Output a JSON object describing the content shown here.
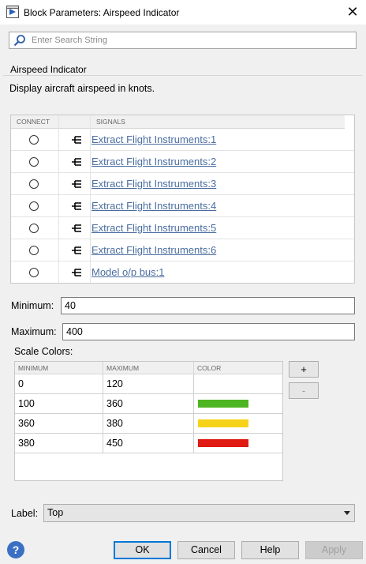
{
  "window": {
    "title": "Block Parameters: Airspeed Indicator",
    "close_glyph": "✕"
  },
  "search": {
    "placeholder": "Enter Search String",
    "value": ""
  },
  "group": {
    "title": "Airspeed Indicator",
    "description": "Display aircraft airspeed in knots."
  },
  "signals_table": {
    "headers": {
      "connect": "CONNECT",
      "port": "",
      "signals": "SIGNALS"
    },
    "rows": [
      {
        "signal": "Extract Flight Instruments:1",
        "connected": false
      },
      {
        "signal": "Extract Flight Instruments:2",
        "connected": false
      },
      {
        "signal": "Extract Flight Instruments:3",
        "connected": false
      },
      {
        "signal": "Extract Flight Instruments:4",
        "connected": false
      },
      {
        "signal": "Extract Flight Instruments:5",
        "connected": false
      },
      {
        "signal": "Extract Flight Instruments:6",
        "connected": false
      },
      {
        "signal": "Model o/p bus:1",
        "connected": false
      }
    ]
  },
  "minimum": {
    "label": "Minimum:",
    "value": "40"
  },
  "maximum": {
    "label": "Maximum:",
    "value": "400"
  },
  "scale_colors": {
    "label": "Scale Colors:",
    "headers": {
      "minimum": "MINIMUM",
      "maximum": "MAXIMUM",
      "color": "COLOR"
    },
    "rows": [
      {
        "minimum": "0",
        "maximum": "120",
        "color": ""
      },
      {
        "minimum": "100",
        "maximum": "360",
        "color": "#4db522"
      },
      {
        "minimum": "360",
        "maximum": "380",
        "color": "#f7d21a"
      },
      {
        "minimum": "380",
        "maximum": "450",
        "color": "#e01b14"
      }
    ],
    "add_label": "+",
    "remove_label": "-"
  },
  "label_setting": {
    "label": "Label:",
    "value": "Top"
  },
  "buttons": {
    "help_glyph": "?",
    "ok": "OK",
    "cancel": "Cancel",
    "help": "Help",
    "apply": "Apply"
  },
  "icons": [
    "app-icon",
    "search-icon",
    "bus-port-icon",
    "help-icon",
    "chevron-down-icon"
  ]
}
